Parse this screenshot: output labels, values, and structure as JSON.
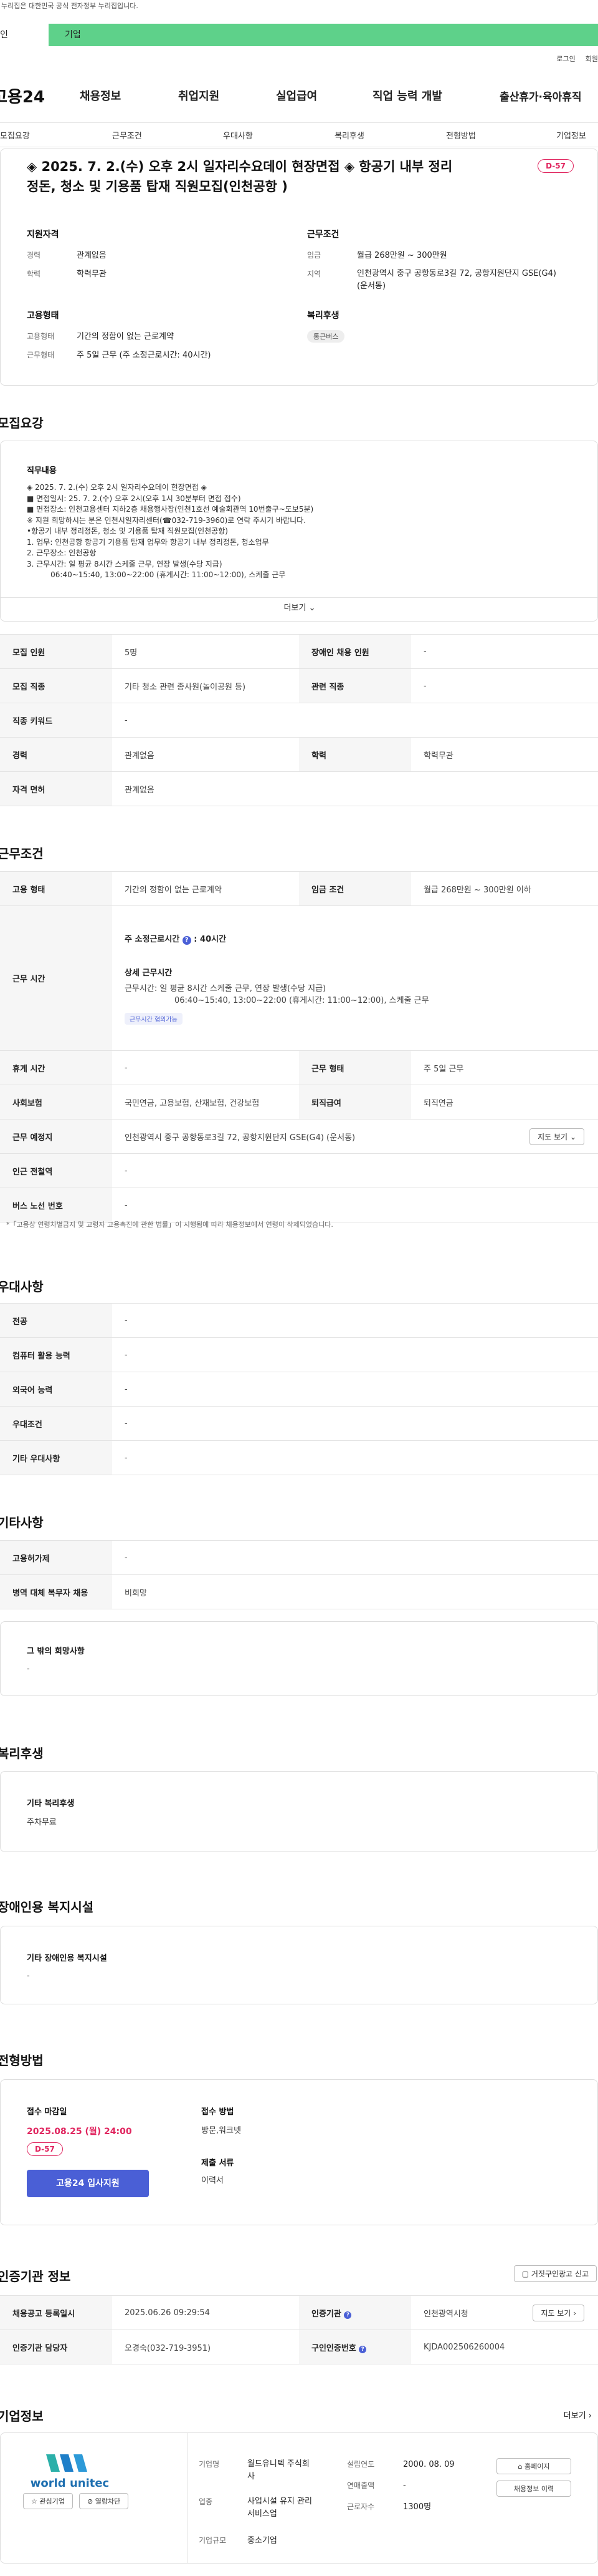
{
  "header": {
    "gov_notice": "누리집은 대한민국 공식 전자정부 누리집입니다.",
    "tab_personal": "인",
    "tab_company": "기업",
    "login": "로그인",
    "signup": "회원",
    "logo": "고용24",
    "gnb": [
      "채용정보",
      "취업지원",
      "실업급여",
      "직업 능력 개발",
      "출산휴가·육아휴직"
    ]
  },
  "subnav": [
    "모집요강",
    "근무조건",
    "우대사항",
    "복리후생",
    "전형방법",
    "기업정보"
  ],
  "summary": {
    "title": "◈ 2025. 7. 2.(수) 오후 2시 일자리수요데이 현장면접 ◈ 항공기 내부 정리정돈, 청소 및 기용품 탑재 직원모집(인천공항 )",
    "dday": "D-57",
    "qual_h": "지원자격",
    "career_k": "경력",
    "career_v": "관계없음",
    "edu_k": "학력",
    "edu_v": "학력무관",
    "cond_h": "근무조건",
    "wage_k": "임금",
    "wage_v": "월급 268만원 ~ 300만원",
    "area_k": "지역",
    "area_v": "인천광역시 중구 공항동로3길 72, 공항지원단지 GSE(G4) (운서동)",
    "emp_h": "고용형태",
    "emptype_k": "고용형태",
    "emptype_v": "기간의 정함이 없는 근로계약",
    "worktype_k": "근무형태",
    "worktype_v": "주 5일 근무 (주 소정근로시간: 40시간)",
    "welfare_h": "복리후생",
    "welfare_pill": "통근버스"
  },
  "recruit": {
    "title": "모집요강",
    "job_h": "직무내용",
    "desc": "◈ 2025. 7. 2.(수) 오후 2시 일자리수요데이 현장면접 ◈\n■ 면접일시: 25. 7. 2.(수) 오후 2시(오후 1시 30분부터 면접 접수)\n■ 면접장소: 인천고용센터 지하2층 채용행사장(인천1호선 예술회관역 10번출구~도보5분)\n※ 지원 희망하시는 분은 인천시일자리센터(☎032-719-3960)로 연락 주시기 바랍니다.\n•항공기 내부 정리정돈, 청소 및 기용품 탑재 직원모집(인천공항)\n1. 업무: 인천공항 항공기 기용품 탑재 업무와 항공기 내부 정리정돈, 청소업무\n2. 근무장소: 인천공항\n3. 근무시간: 일 평균 8시간 스케줄 근무, 연장 발생(수당 지급)\n          06:40~15:40, 13:00~22:00 (휴게시간: 11:00~12:00), 스케줄 근무",
    "more": "더보기",
    "rows": [
      [
        "모집 인원",
        "5명",
        "장애인 채용 인원",
        "-"
      ],
      [
        "모집 직종",
        "기타 청소 관련 종사원(놀이공원 등)",
        "관련 직종",
        "-"
      ],
      [
        "직종 키워드",
        "-"
      ],
      [
        "경력",
        "관계없음",
        "학력",
        "학력무관"
      ],
      [
        "자격 면허",
        "관계없음"
      ]
    ]
  },
  "work": {
    "title": "근무조건",
    "type_h": "고용 형태",
    "type_v": "기간의 정함이 없는 근로계약",
    "wage_h": "임금 조건",
    "wage_v": "월급 268만원 ~ 300만원 이하",
    "time_h": "근무 시간",
    "hours": "주 소정근로시간",
    "hours_v": "40시간",
    "detail_h": "상세 근무시간",
    "detail_1": "근무시간: 일 평균 8시간 스케줄 근무, 연장 발생(수당 지급)",
    "detail_2": "06:40~15:40, 13:00~22:00 (휴게시간: 11:00~12:00), 스케줄 근무",
    "flex": "근무시간 협의가능",
    "rest_h": "휴게 시간",
    "rest_v": "-",
    "form_h": "근무 형태",
    "form_v": "주 5일 근무",
    "ins_h": "사회보험",
    "ins_v": "국민연금, 고용보험, 산재보험, 건강보험",
    "ret_h": "퇴직급여",
    "ret_v": "퇴직연금",
    "place_h": "근무 예정지",
    "place_v": "인천광역시 중구 공항동로3길 72, 공항지원단지 GSE(G4) (운서동)",
    "map_btn": "지도 보기",
    "subway_h": "인근 전철역",
    "subway_v": "-",
    "bus_h": "버스 노선 번호",
    "bus_v": "-",
    "note": "*「고용상 연령차별금지 및 고령자 고용촉진에 관한 법률」이 시행됨에 따라 채용정보에서 연령이 삭제되었습니다."
  },
  "pref": {
    "title": "우대사항",
    "rows": [
      [
        "전공",
        "-"
      ],
      [
        "컴퓨터 활용 능력",
        "-"
      ],
      [
        "외국어 능력",
        "-"
      ],
      [
        "우대조건",
        "-"
      ],
      [
        "기타 우대사항",
        "-"
      ]
    ]
  },
  "etc": {
    "title": "기타사항",
    "rows": [
      [
        "고용허가제",
        "-"
      ],
      [
        "병역 대체 복무자 채용",
        "비희망"
      ]
    ],
    "hope_h": "그 밖의 희망사항",
    "hope_v": "-"
  },
  "welfare": {
    "title": "복리후생",
    "h": "기타 복리후생",
    "v": "주차무료"
  },
  "disabled": {
    "title": "장애인용 복지시설",
    "h": "기타 장애인용 복지시설",
    "v": "-"
  },
  "select": {
    "title": "전형방법",
    "deadline_h": "접수 마감일",
    "deadline_v": "2025.08.25 (월) 24:00",
    "dday": "D-57",
    "apply_btn": "고용24 입사지원",
    "method_h": "접수 방법",
    "method_v": "방문,워크넷",
    "docs_h": "제출 서류",
    "docs_v": "이력서"
  },
  "cert": {
    "title": "인증기관 정보",
    "report_btn": "거짓구인광고 신고",
    "reg_h": "채용공고 등록일시",
    "reg_v": "2025.06.26 09:29:54",
    "org_h": "인증기관",
    "org_v": "인천광역시청",
    "org_btn": "지도 보기",
    "mgr_h": "인증기관 담당자",
    "mgr_v": "오경숙(032-719-3951)",
    "num_h": "구인인증번호",
    "num_v": "KJDA002506260004"
  },
  "company": {
    "title": "기업정보",
    "more": "더보기",
    "logo_text": "world unitec",
    "fav_btn": "관심기업",
    "block_btn": "열람차단",
    "name_k": "기업명",
    "name_v": "월드유니텍 주식회사",
    "found_k": "설립연도",
    "found_v": "2000. 08. 09",
    "home_btn": "홈페이지",
    "ind_k": "업종",
    "ind_v": "사업시설 유지 관리 서비스업",
    "sales_k": "연매출액",
    "sales_v": "-",
    "jobs_btn": "채용정보 이력",
    "emp_k": "근로자수",
    "emp_v": "1300명",
    "size_k": "기업규모",
    "size_v": "중소기업"
  },
  "colors": {
    "accent": "#5ed18a",
    "primary": "#4a5fd6",
    "dday": "#e0245e"
  }
}
